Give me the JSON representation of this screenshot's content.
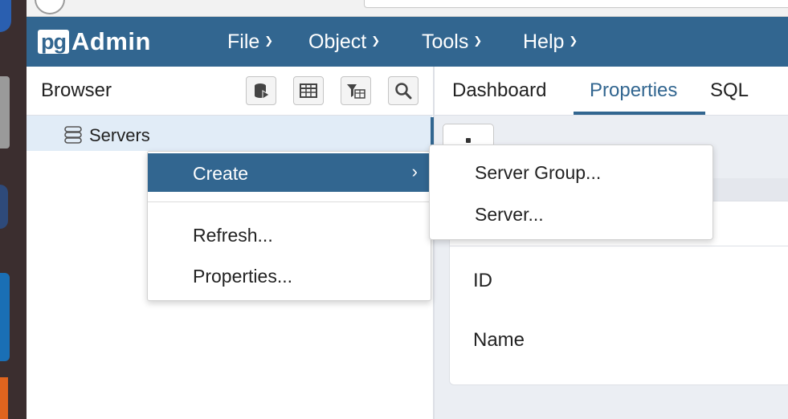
{
  "app": {
    "logo_pg": "pg",
    "logo_admin": "Admin"
  },
  "menu": [
    {
      "label": "File"
    },
    {
      "label": "Object"
    },
    {
      "label": "Tools"
    },
    {
      "label": "Help"
    }
  ],
  "browser": {
    "title": "Browser",
    "tree": [
      {
        "label": "Servers",
        "icon": "server-group-icon"
      }
    ]
  },
  "tabs": [
    {
      "label": "Dashboard",
      "active": false
    },
    {
      "label": "Properties",
      "active": true
    },
    {
      "label": "SQL",
      "active": false
    }
  ],
  "properties": {
    "fields": [
      "ID",
      "Name"
    ]
  },
  "context_menu": {
    "items": [
      {
        "label": "Create",
        "has_submenu": true,
        "active": true
      },
      {
        "label": "Refresh...",
        "has_submenu": false,
        "active": false
      },
      {
        "label": "Properties...",
        "has_submenu": false,
        "active": false
      }
    ],
    "submenu": [
      {
        "label": "Server Group..."
      },
      {
        "label": "Server..."
      }
    ]
  },
  "colors": {
    "brand": "#326690",
    "selection": "#e1ecf7",
    "panel_bg": "#ebeef3"
  }
}
